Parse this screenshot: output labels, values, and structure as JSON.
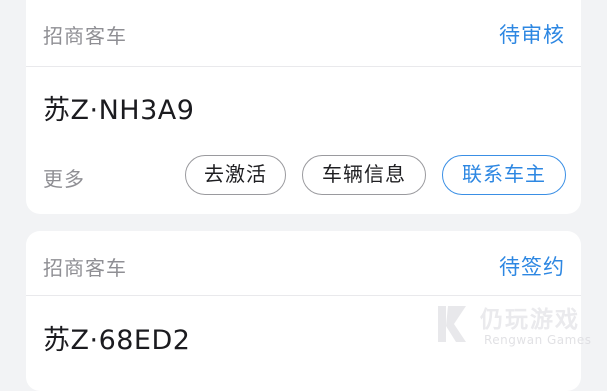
{
  "cards": [
    {
      "type_label": "招商客车",
      "status": "待审核",
      "plate": "苏Z·NH3A9",
      "more_label": "更多",
      "actions": [
        "去激活",
        "车辆信息",
        "联系车主"
      ]
    },
    {
      "type_label": "招商客车",
      "status": "待签约",
      "plate": "苏Z·68ED2"
    }
  ],
  "watermark": {
    "title": "仍玩游戏",
    "subtitle": "Rengwan Games"
  },
  "colors": {
    "accent": "#2d87e2",
    "background": "#f2f3f5",
    "card": "#ffffff",
    "muted_text": "#8f8f94"
  }
}
